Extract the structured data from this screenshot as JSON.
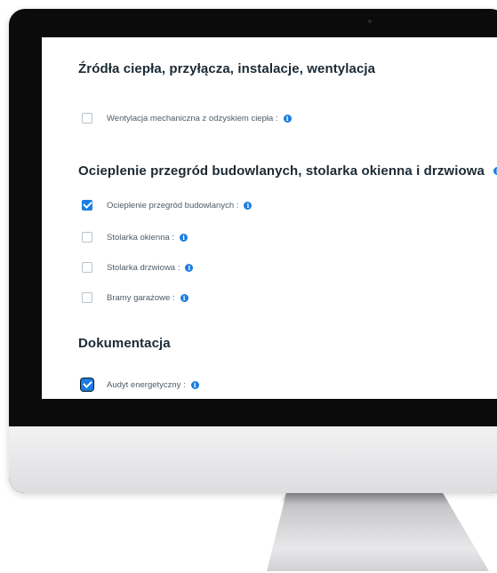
{
  "sections": [
    {
      "title": "Źródła ciepła, przyłącza, instalacje, wentylacja",
      "has_info": false,
      "items": [
        {
          "label": "Wentylacja mechaniczna z odzyskiem ciepła :",
          "checked": false,
          "info_icon": "info-icon"
        }
      ]
    },
    {
      "title": "Ocieplenie przegród budowlanych, stolarka okienna i drzwiowa",
      "has_info": true,
      "items": [
        {
          "label": "Ocieplenie przegród budowlanych :",
          "checked": true,
          "info_icon": "info-icon"
        },
        {
          "label": "Stolarka okienna :",
          "checked": false,
          "info_icon": "info-icon"
        },
        {
          "label": "Stolarka drzwiowa :",
          "checked": false,
          "info_icon": "info-icon"
        },
        {
          "label": "Bramy garażowe :",
          "checked": false,
          "info_icon": "info-icon"
        }
      ]
    },
    {
      "title": "Dokumentacja",
      "has_info": false,
      "items": [
        {
          "label": "Audyt energetyczny :",
          "checked": true,
          "info_icon": "info-icon"
        }
      ]
    }
  ],
  "info_glyph": "i",
  "colors": {
    "accent": "#1b7de2",
    "title_text": "#1b2a35",
    "label_text": "#4e5c66",
    "monitor_bezel": "#0b0b0b",
    "monitor_chin": "#e6e6e8"
  }
}
